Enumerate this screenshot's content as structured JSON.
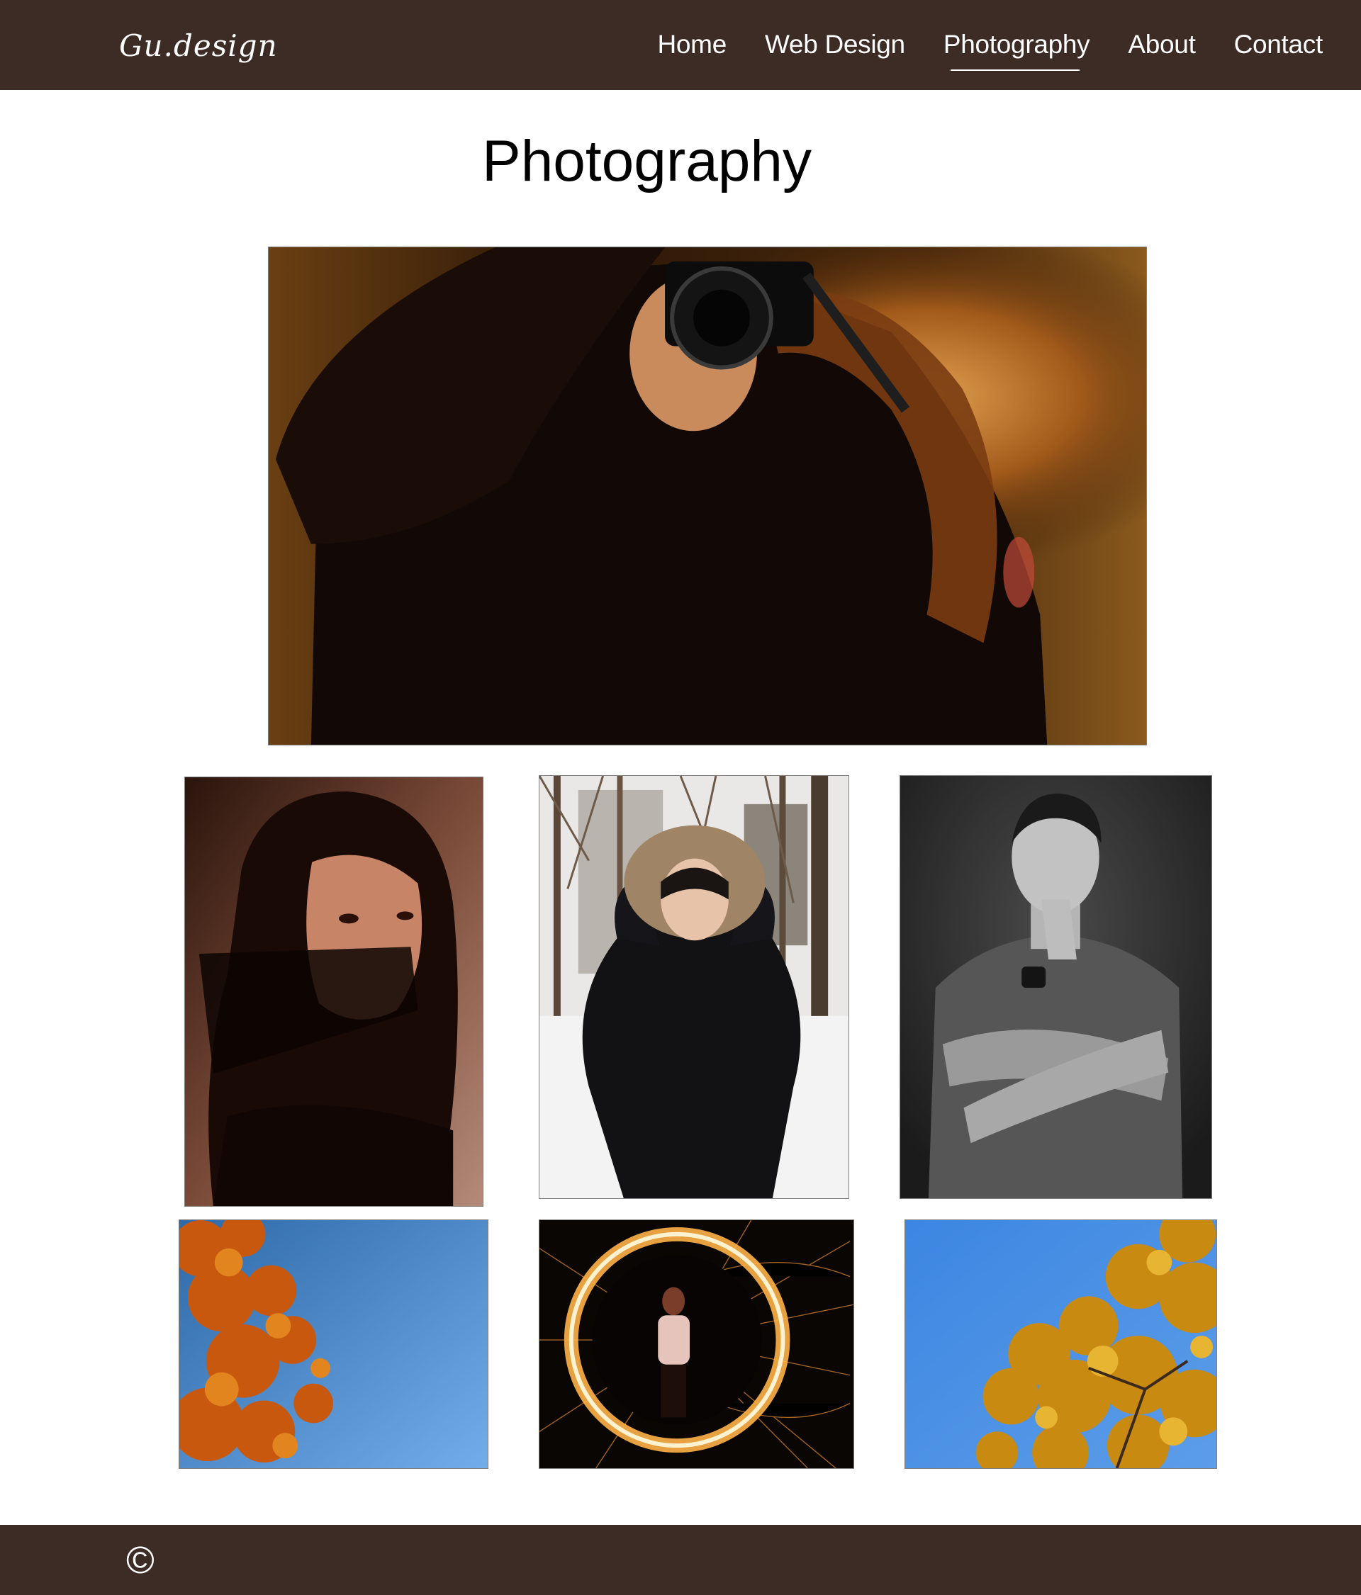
{
  "header": {
    "logo_text": "Gu.design",
    "nav": [
      {
        "label": "Home",
        "active": false
      },
      {
        "label": "Web Design",
        "active": false
      },
      {
        "label": "Photography",
        "active": true
      },
      {
        "label": "About",
        "active": false
      },
      {
        "label": "Contact",
        "active": false
      }
    ]
  },
  "main": {
    "title": "Photography",
    "photos": [
      {
        "subject": "woman with camera taking mirror photo"
      },
      {
        "subject": "portrait of woman with hair in shadow"
      },
      {
        "subject": "woman in winter parka in snowy park"
      },
      {
        "subject": "black and white portrait of tattooed man"
      },
      {
        "subject": "orange autumn leaves against blue sky"
      },
      {
        "subject": "steel wool light painting circle"
      },
      {
        "subject": "yellow autumn tree against blue sky"
      }
    ]
  },
  "footer": {
    "copyright_symbol": "©"
  },
  "colors": {
    "header_bg": "#3d2b25",
    "footer_bg": "#3d2b25",
    "nav_text": "#ffffff",
    "title_text": "#000000"
  }
}
